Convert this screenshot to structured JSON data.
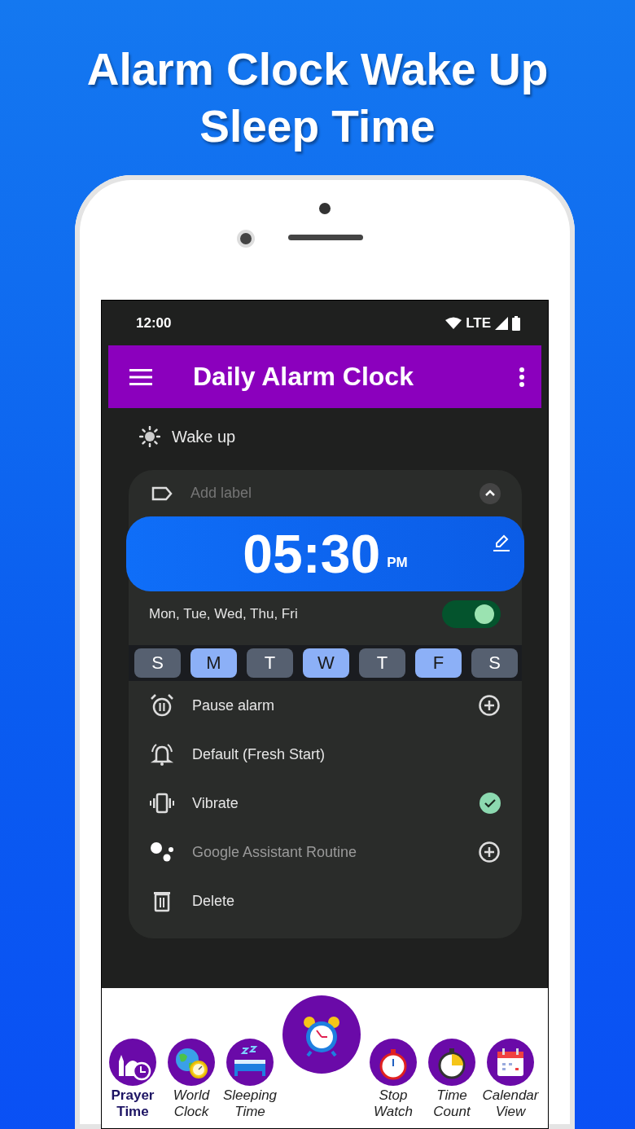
{
  "headline": "Alarm Clock Wake Up Sleep Time",
  "status_bar": {
    "time": "12:00",
    "network": "LTE"
  },
  "app_bar": {
    "title": "Daily Alarm Clock"
  },
  "section": {
    "title": "Wake up"
  },
  "alarm": {
    "label_placeholder": "Add label",
    "time": "05:30",
    "period": "PM",
    "repeat": "Mon, Tue, Wed, Thu, Fri",
    "on": true,
    "expanded": true,
    "days": [
      {
        "label": "S",
        "selected": false
      },
      {
        "label": "M",
        "selected": true
      },
      {
        "label": "T",
        "selected": false
      },
      {
        "label": "W",
        "selected": true
      },
      {
        "label": "T",
        "selected": false
      },
      {
        "label": "F",
        "selected": true
      },
      {
        "label": "S",
        "selected": false
      }
    ],
    "options": [
      {
        "label": "Pause alarm",
        "kind": "add",
        "disabled": false
      },
      {
        "label": "Default (Fresh Start)",
        "kind": "plain",
        "disabled": false
      },
      {
        "label": "Vibrate",
        "kind": "check",
        "disabled": false
      },
      {
        "label": "Google Assistant Routine",
        "kind": "add",
        "disabled": true
      },
      {
        "label": "Delete",
        "kind": "plain",
        "disabled": false
      }
    ]
  },
  "bottom_nav": {
    "left": [
      {
        "label": "Prayer Time",
        "selected": true
      },
      {
        "label": "World Clock",
        "selected": false
      },
      {
        "label": "Sleeping Time",
        "selected": false
      }
    ],
    "right": [
      {
        "label": "Stop Watch",
        "selected": false
      },
      {
        "label": "Time Count",
        "selected": false
      },
      {
        "label": "Calendar View",
        "selected": false
      }
    ]
  }
}
